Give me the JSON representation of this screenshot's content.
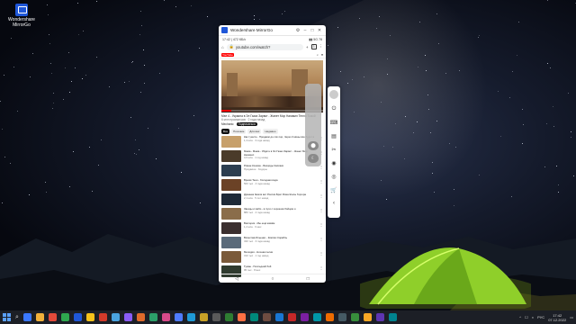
{
  "desktop": {
    "icon_label": "Wondershare MirrorGo"
  },
  "window": {
    "title": "Wondershare MirrorGo",
    "controls": [
      "⚙",
      "–",
      "□",
      "✕"
    ]
  },
  "phone": {
    "status_left": "17:42 | 472 КБ/с",
    "status_right": "▮▮ 5G 78",
    "url": "youtube.com/watch?",
    "tabs_count": "3",
    "yt_logo_text": "YouTube",
    "video_title": "Мел 4 - Украина в Эл Газах Зарвот - Жанет Мор Нагамил Тепло Тьмой",
    "video_sub": "6 млн просмотров · 2 года назад",
    "channel": "Mechanic",
    "subscribe": "Подписаться",
    "chips": [
      "Все",
      "Похожие",
      "Для вас",
      "Недавно"
    ],
    "list": [
      {
        "title": "Как тушите - Продаём до сих пор, Через 3 мины все будет в",
        "meta": "1,4 млн · 3 года назад"
      },
      {
        "title": "Мама - Мама - Уйдите в Эл Газах Зарвот - Жанет Мор Нагамил",
        "meta": "3,6 млн · 1 год назад"
      },
      {
        "title": "Роман Кошкин - Бахорды Капсаки",
        "meta": "Продакшн · Ходоры"
      },
      {
        "title": "Время Тени - Холодная вода",
        "meta": "560 тыс · 4 года назад"
      },
      {
        "title": "Дрянная Земля вот Россия Брат Рома Жолы Горгора",
        "meta": "2,1 млн · 5 лет назад"
      },
      {
        "title": "Звезды и Небо - в пути с хорошим бойцом и",
        "meta": "880 тыс · 2 года назад"
      },
      {
        "title": "Виктория - Мы ещё живём",
        "meta": "1,2 млн · 6 мес"
      },
      {
        "title": "Вячеслав Ильенко - Кимлих Корабль",
        "meta": "430 тыс · 3 года назад"
      },
      {
        "title": "Мелодия - Ночная песня",
        "meta": "310 тыс · 1 год назад"
      },
      {
        "title": "Туман - Последний бой",
        "meta": "95 тыс · 8 мес"
      }
    ],
    "nav": [
      "◁",
      "○",
      "□"
    ]
  },
  "side_panel": {
    "icons": [
      "⏻",
      "⌨",
      "▤",
      "✂",
      "◉",
      "◎",
      "🛒",
      "‹"
    ]
  },
  "float_panel": {
    "buttons": [
      "⬤",
      "☾"
    ]
  },
  "taskbar": {
    "time": "17:42",
    "date": "07.12.2022",
    "lang": "РУС",
    "app_colors": [
      "#3a78ff",
      "#f2b13a",
      "#e34a3a",
      "#2fa84f",
      "#1f57d8",
      "#f7c21a",
      "#d23a2a",
      "#4aa3df",
      "#8a5cf5",
      "#e06a2a",
      "#2c9f6a",
      "#d84a8a",
      "#4f7cff",
      "#1f9ad6",
      "#c9a227",
      "#5a5a5a",
      "#2e7d32",
      "#ff7043",
      "#00897b",
      "#6d4c41",
      "#1976d2",
      "#c62828",
      "#7b1fa2",
      "#0097a7",
      "#ef6c00",
      "#455a64",
      "#388e3c",
      "#f9a825",
      "#5e35b1",
      "#00838f"
    ]
  },
  "thumb_colors": [
    "#c7a06b",
    "#4a3b2a",
    "#2c3e50",
    "#6b4226",
    "#1e2a38",
    "#8a6d4a",
    "#3b2f2f",
    "#5a6a7a",
    "#7a5a3a",
    "#2f3b2f"
  ]
}
